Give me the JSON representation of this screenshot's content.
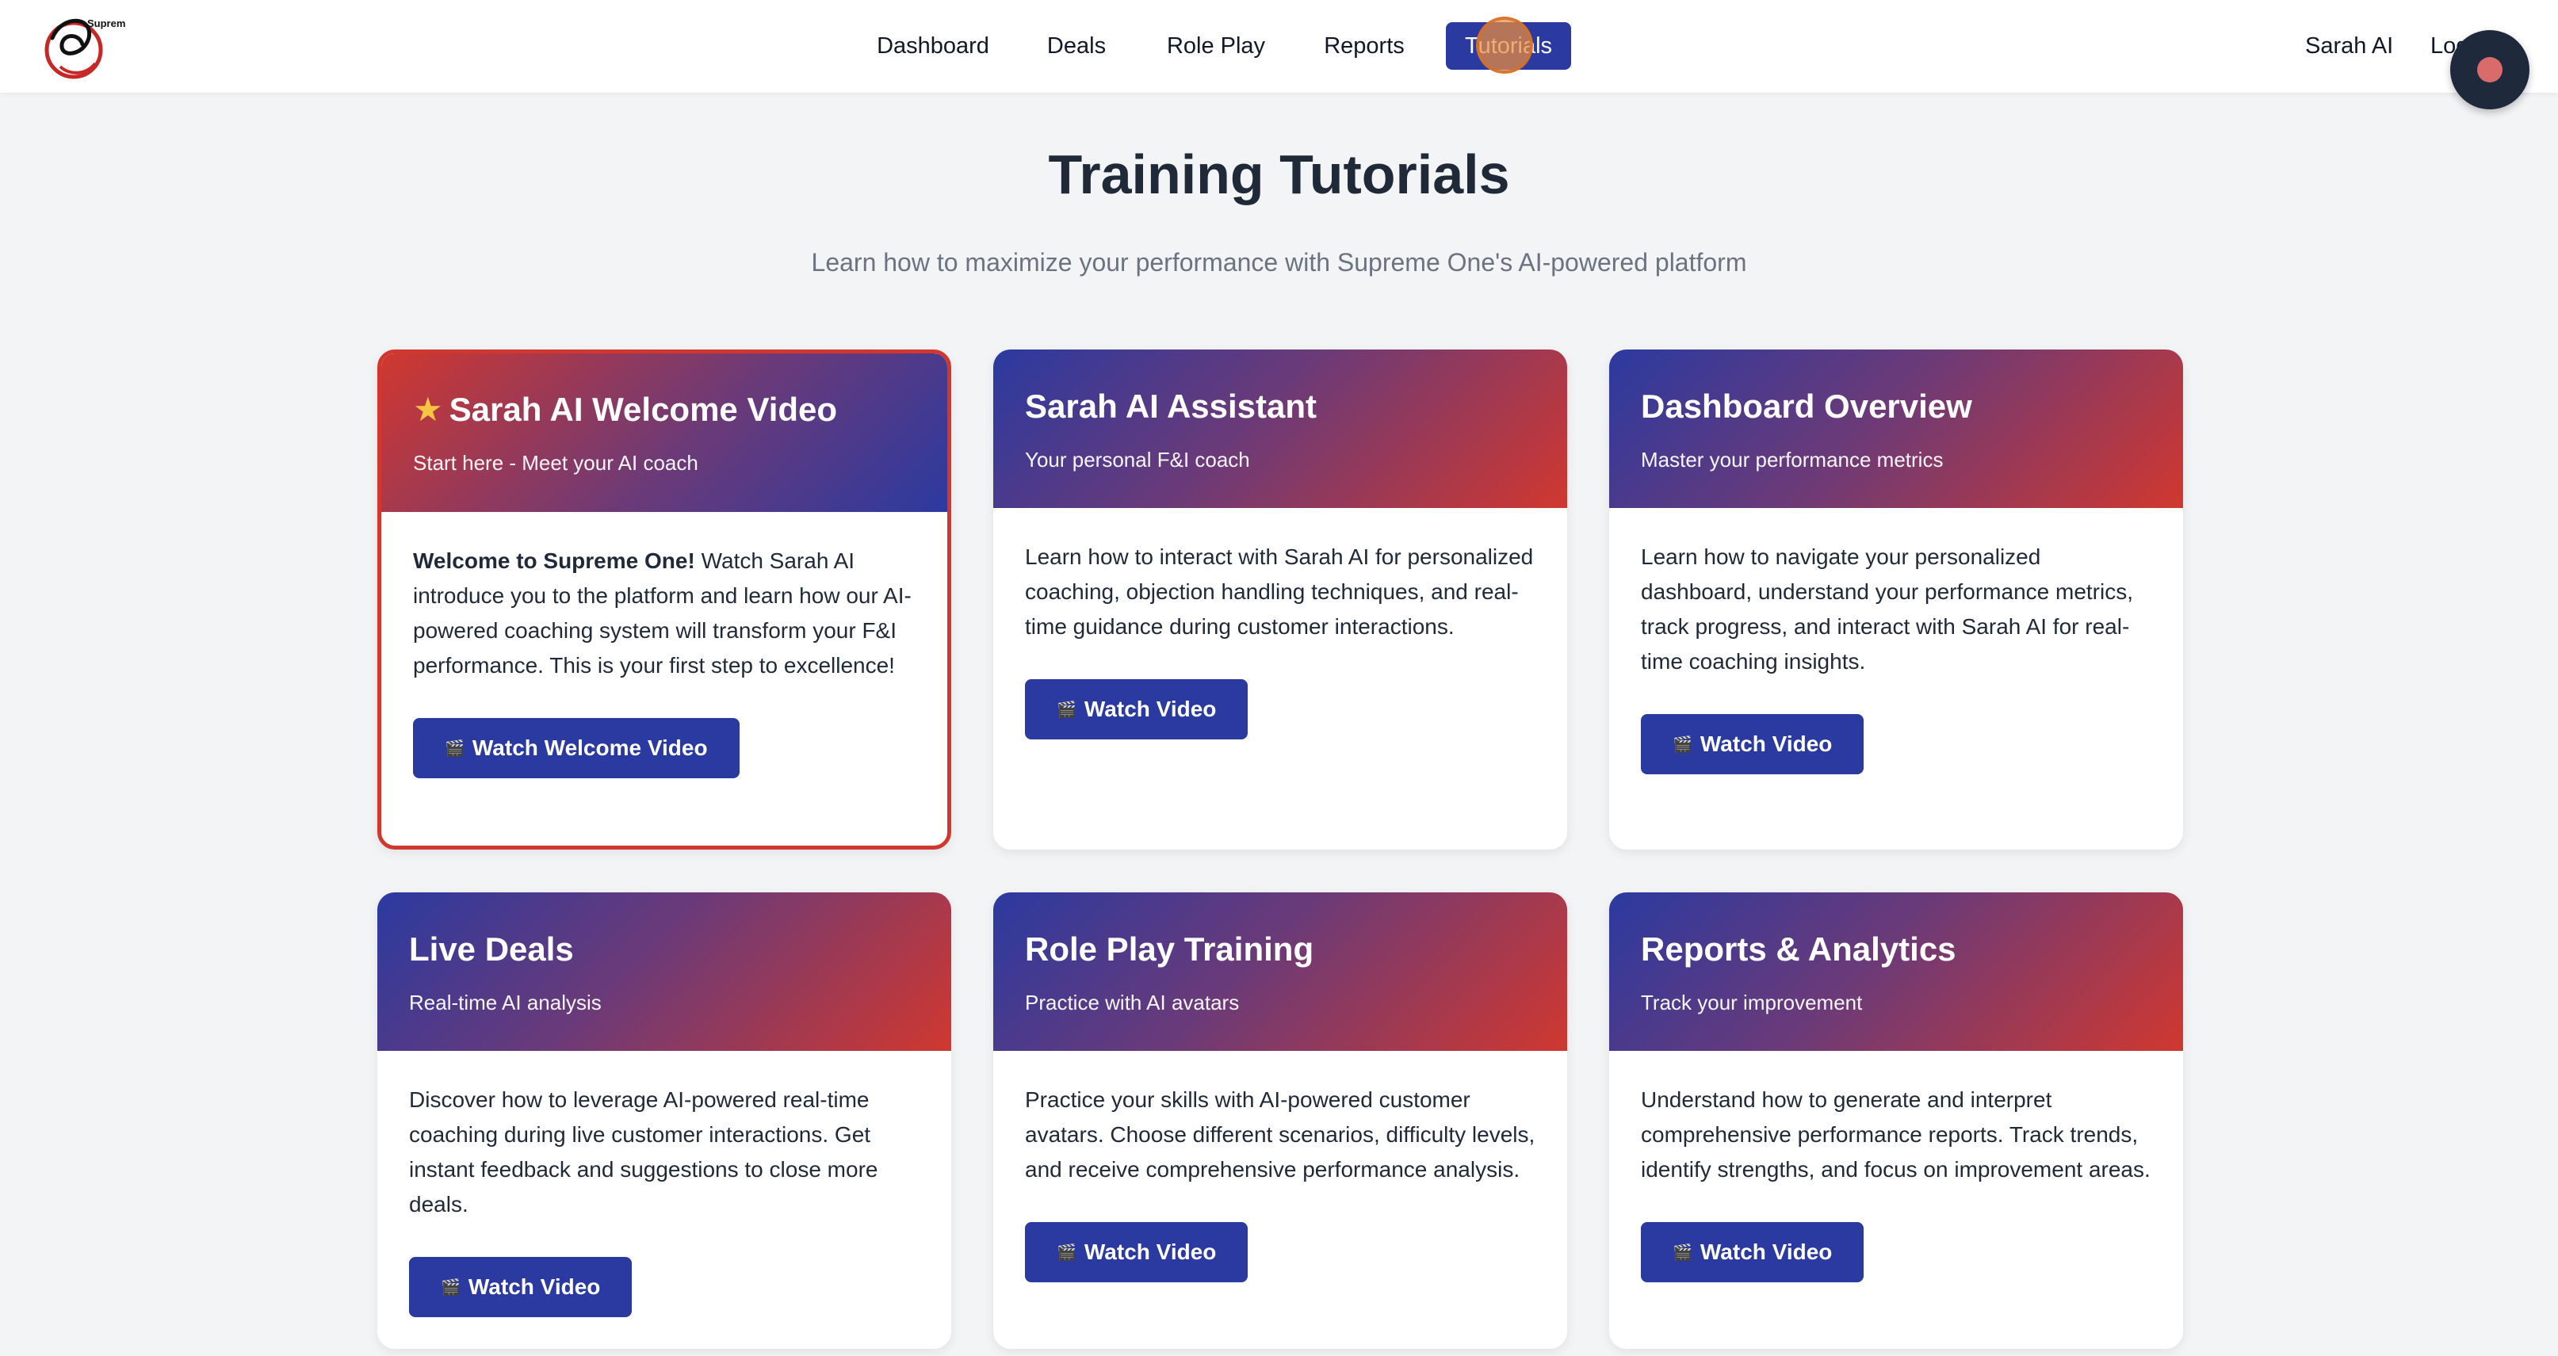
{
  "nav": {
    "logo_text": "Supreme One",
    "links": [
      "Dashboard",
      "Deals",
      "Role Play",
      "Reports",
      "Tutorials"
    ],
    "active_link": "Tutorials",
    "right": [
      "Sarah AI",
      "Log"
    ]
  },
  "page": {
    "title": "Training Tutorials",
    "subtitle": "Learn how to maximize your performance with Supreme One's AI-powered platform"
  },
  "cards": [
    {
      "title": "Sarah AI Welcome Video",
      "subtitle": "Start here - Meet your AI coach",
      "lead": "Welcome to Supreme One!",
      "body": " Watch Sarah AI introduce you to the platform and learn how our AI-powered coaching system will transform your F&I performance. This is your first step to excellence!",
      "button": "Watch Welcome Video",
      "featured": true
    },
    {
      "title": "Sarah AI Assistant",
      "subtitle": "Your personal F&I coach",
      "body": "Learn how to interact with Sarah AI for personalized coaching, objection handling techniques, and real-time guidance during customer interactions.",
      "button": "Watch Video"
    },
    {
      "title": "Dashboard Overview",
      "subtitle": "Master your performance metrics",
      "body": "Learn how to navigate your personalized dashboard, understand your performance metrics, track progress, and interact with Sarah AI for real-time coaching insights.",
      "button": "Watch Video"
    },
    {
      "title": "Live Deals",
      "subtitle": "Real-time AI analysis",
      "body": "Discover how to leverage AI-powered real-time coaching during live customer interactions. Get instant feedback and suggestions to close more deals.",
      "button": "Watch Video"
    },
    {
      "title": "Role Play Training",
      "subtitle": "Practice with AI avatars",
      "body": "Practice your skills with AI-powered customer avatars. Choose different scenarios, difficulty levels, and receive comprehensive performance analysis.",
      "button": "Watch Video"
    },
    {
      "title": "Reports & Analytics",
      "subtitle": "Track your improvement",
      "body": "Understand how to generate and interpret comprehensive performance reports. Track trends, identify strengths, and focus on improvement areas.",
      "button": "Watch Video"
    }
  ],
  "icons": {
    "star": "star-icon",
    "film": "film-icon",
    "record": "record-icon"
  },
  "colors": {
    "primary": "#2b3aa0",
    "accent": "#d0382f",
    "background": "#f3f4f6"
  }
}
